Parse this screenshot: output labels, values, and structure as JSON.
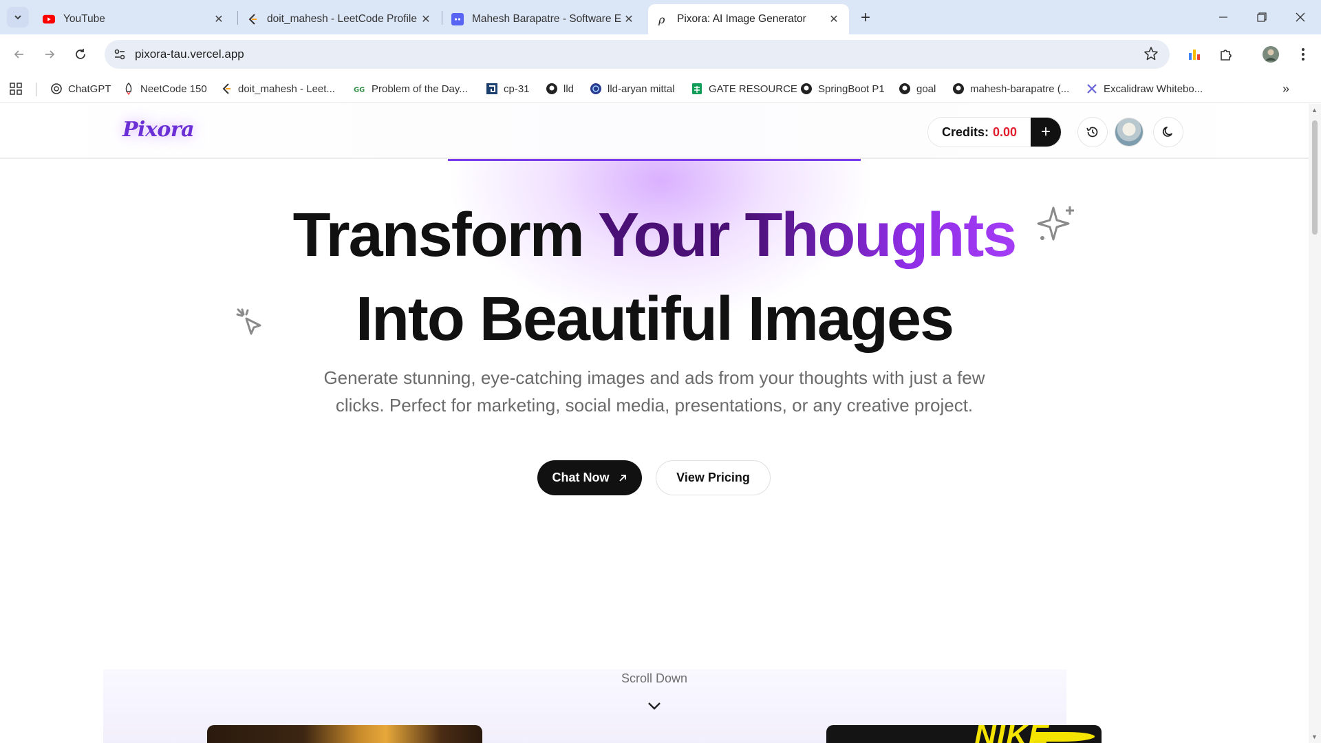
{
  "browser": {
    "tabs": [
      {
        "title": "YouTube",
        "icon": "youtube-icon",
        "active": false
      },
      {
        "title": "doit_mahesh - LeetCode Profile",
        "icon": "leetcode-icon",
        "active": false
      },
      {
        "title": "Mahesh Barapatre - Software E",
        "icon": "discord-icon",
        "active": false
      },
      {
        "title": "Pixora: AI Image Generator",
        "icon": "pixora-icon",
        "active": true
      }
    ],
    "url": "pixora-tau.vercel.app",
    "bookmarks": [
      {
        "label": "ChatGPT",
        "icon": "openai-icon"
      },
      {
        "label": "NeetCode 150",
        "icon": "rocket-icon"
      },
      {
        "label": "doit_mahesh - Leet...",
        "icon": "leetcode-icon"
      },
      {
        "label": "Problem of the Day...",
        "icon": "gfg-icon"
      },
      {
        "label": "cp-31",
        "icon": "cp-icon"
      },
      {
        "label": "lld",
        "icon": "github-icon"
      },
      {
        "label": "lld-aryan mittal",
        "icon": "circle-icon"
      },
      {
        "label": "GATE RESOURCE",
        "icon": "sheets-icon"
      },
      {
        "label": "SpringBoot P1",
        "icon": "github-icon"
      },
      {
        "label": "goal",
        "icon": "github-icon"
      },
      {
        "label": "mahesh-barapatre (...",
        "icon": "github-icon"
      },
      {
        "label": "Excalidraw Whitebo...",
        "icon": "excalidraw-icon"
      }
    ]
  },
  "site": {
    "logo": "Pixora",
    "credits_label": "Credits:",
    "credits_value": "0.00",
    "credits_add": "+",
    "hero_line1_word1": "Transform",
    "hero_line1_word2": "Your",
    "hero_line1_word3": "Thoughts",
    "hero_line2": "Into Beautiful Images",
    "subtitle": "Generate stunning, eye-catching images and ads from your thoughts with just a few clicks. Perfect for marketing, social media, presentations, or any creative project.",
    "chat_button": "Chat Now",
    "pricing_button": "View Pricing",
    "scroll_down": "Scroll Down",
    "card_right_text": "NIKE"
  },
  "colors": {
    "accent_purple": "#7c3aed",
    "credits_red": "#e11d2e",
    "dark": "#111111"
  }
}
